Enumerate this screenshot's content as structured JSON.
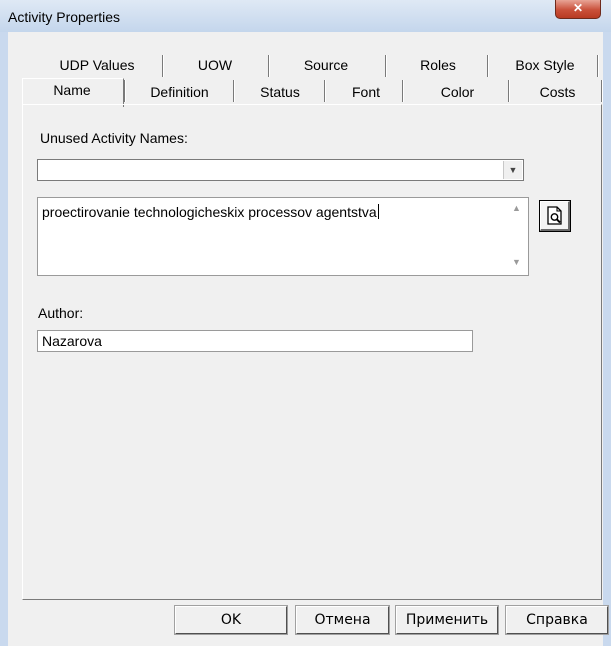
{
  "window": {
    "title": "Activity Properties"
  },
  "tabs_row1": [
    "UDP Values",
    "UOW",
    "Source",
    "Roles",
    "Box Style"
  ],
  "tabs_row2": [
    "Name",
    "Definition",
    "Status",
    "Font",
    "Color",
    "Costs"
  ],
  "active_tab": "Name",
  "name_tab": {
    "unused_label": "Unused Activity Names:",
    "unused_value": "",
    "name_value": "proectirovanie technologicheskix processov agentstva",
    "author_label": "Author:",
    "author_value": "Nazarova"
  },
  "buttons": {
    "ok": "OK",
    "cancel": "Отмена",
    "apply": "Применить",
    "help": "Справка"
  },
  "icons": {
    "close": "close-icon",
    "dropdown": "chevron-down-icon",
    "browse": "magnifier-document-icon"
  }
}
